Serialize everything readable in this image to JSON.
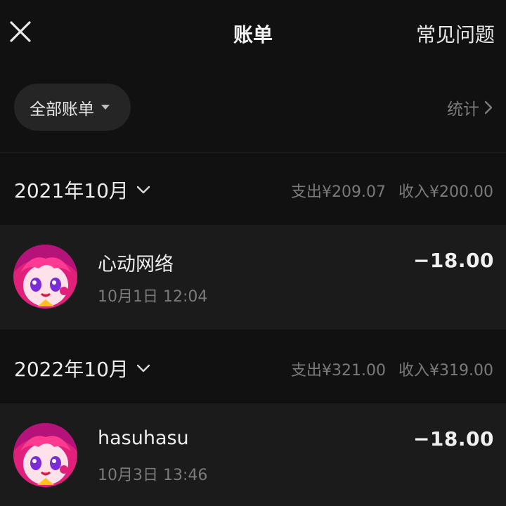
{
  "header": {
    "title": "账单",
    "faq_label": "常见问题"
  },
  "filter": {
    "label": "全部账单",
    "stats_label": "统计"
  },
  "months": [
    {
      "label": "2021年10月",
      "expense": "支出¥209.07",
      "income": "收入¥200.00",
      "transactions": [
        {
          "name": "心动网络",
          "time": "10月1日 12:04",
          "amount": "−18.00"
        }
      ]
    },
    {
      "label": "2022年10月",
      "expense": "支出¥321.00",
      "income": "收入¥319.00",
      "transactions": [
        {
          "name": "hasuhasu",
          "time": "10月3日 13:46",
          "amount": "−18.00"
        }
      ]
    }
  ],
  "colors": {
    "background": "#111111",
    "row": "#1b1b1b",
    "pill": "#252525",
    "muted": "#7a7a7a"
  },
  "icons": [
    "close-icon",
    "caret-down-icon",
    "chevron-right-icon",
    "chevron-down-icon",
    "avatar-icon"
  ]
}
